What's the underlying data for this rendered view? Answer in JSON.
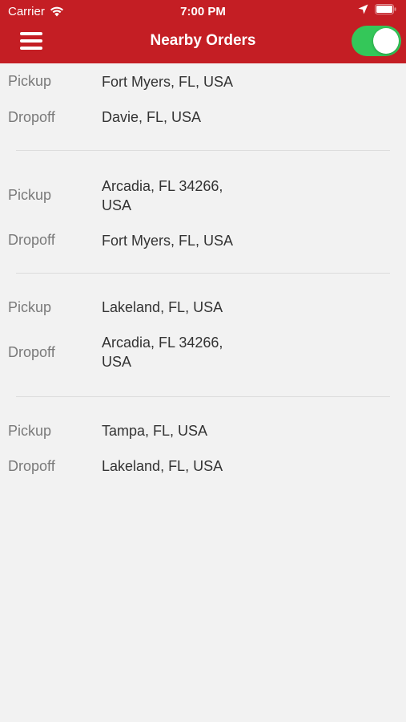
{
  "status_bar": {
    "carrier": "Carrier",
    "time": "7:00 PM"
  },
  "header": {
    "title": "Nearby Orders",
    "toggle_on": true,
    "background_color": "#c41e24",
    "toggle_color": "#34c759"
  },
  "labels": {
    "pickup": "Pickup",
    "dropoff": "Dropoff"
  },
  "orders": [
    {
      "pickup": "Fort Myers, FL, USA",
      "dropoff": "Davie, FL, USA"
    },
    {
      "pickup": "Arcadia, FL 34266, USA",
      "dropoff": "Fort Myers, FL, USA"
    },
    {
      "pickup": "Lakeland, FL, USA",
      "dropoff": "Arcadia, FL 34266, USA"
    },
    {
      "pickup": "Tampa, FL, USA",
      "dropoff": "Lakeland, FL, USA"
    }
  ]
}
